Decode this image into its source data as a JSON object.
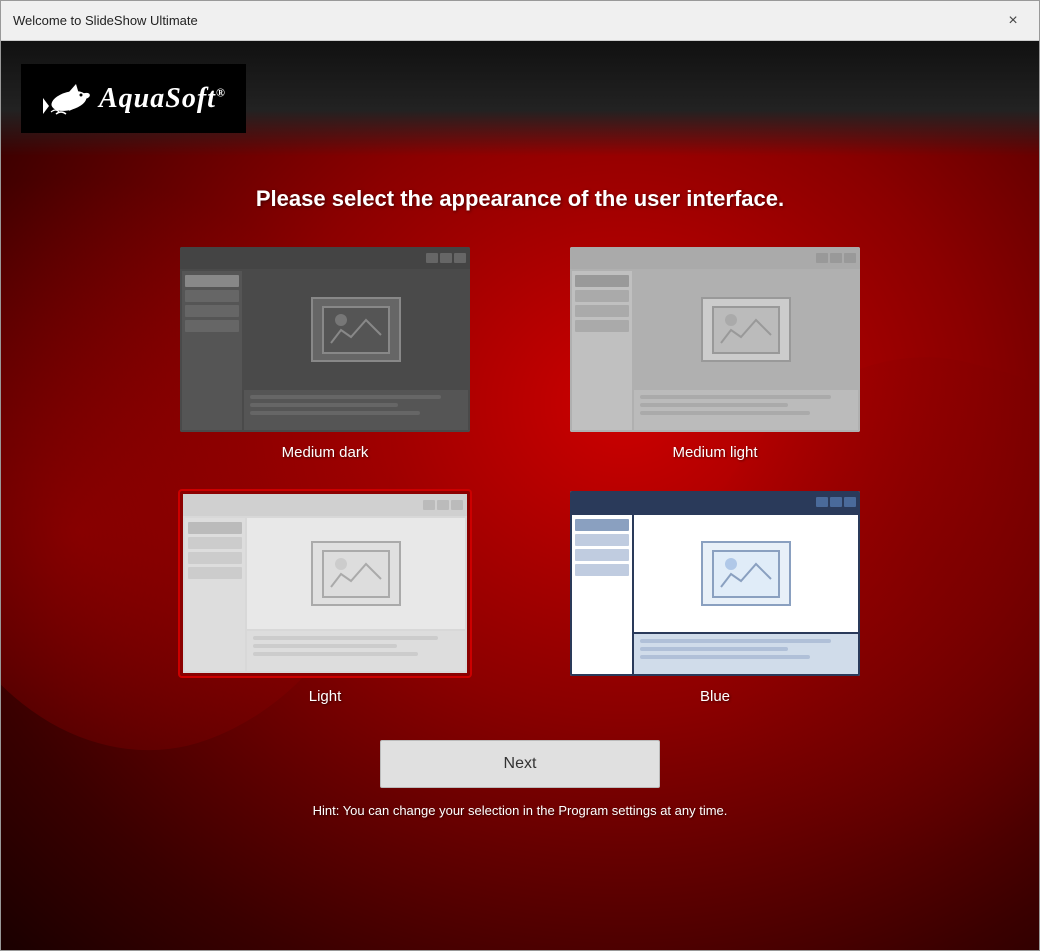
{
  "window": {
    "title": "Welcome to SlideShow Ultimate",
    "close_label": "×"
  },
  "logo": {
    "brand_name": "AquaSoft",
    "reg_symbol": "®"
  },
  "heading": "Please select the appearance of the user interface.",
  "themes": [
    {
      "id": "medium-dark",
      "label": "Medium dark",
      "selected": false
    },
    {
      "id": "medium-light",
      "label": "Medium light",
      "selected": false
    },
    {
      "id": "light",
      "label": "Light",
      "selected": true
    },
    {
      "id": "blue",
      "label": "Blue",
      "selected": false
    }
  ],
  "next_button": "Next",
  "hint": "Hint: You can change your selection in the Program settings at any time."
}
